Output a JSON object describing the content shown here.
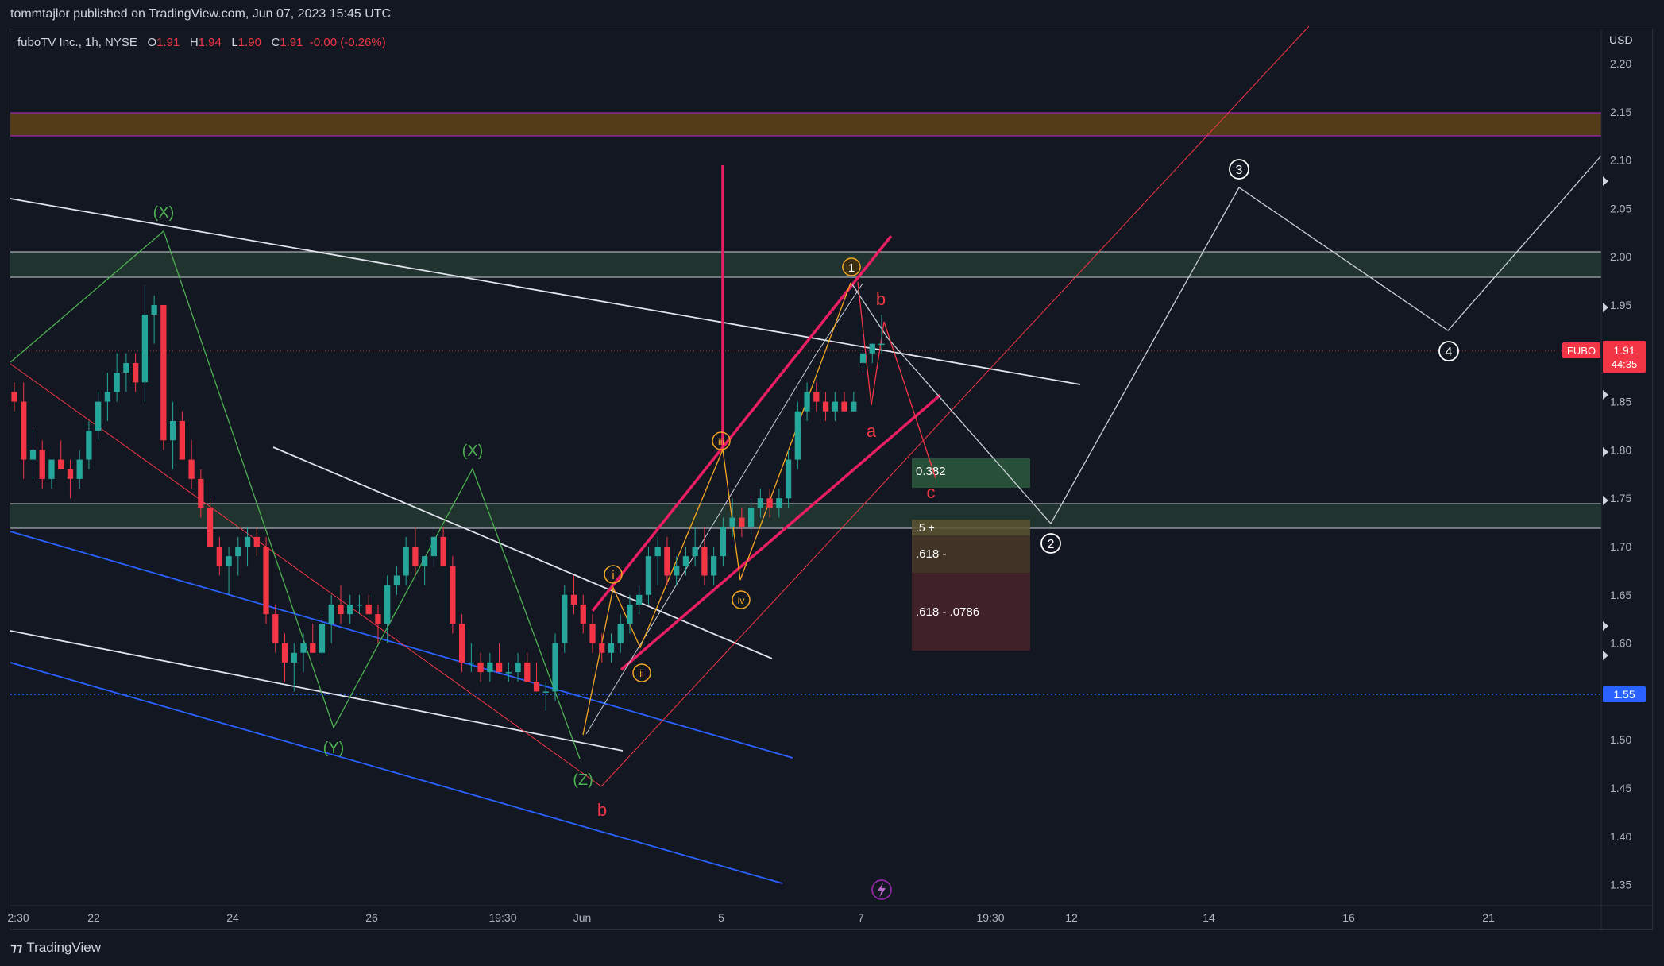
{
  "header": {
    "publisher": "tommtajlor published on TradingView.com, Jun 07, 2023 15:45 UTC"
  },
  "legend": {
    "symbol": "fuboTV Inc., 1h, NYSE",
    "o_label": "O",
    "o_value": "1.91",
    "h_label": "H",
    "h_value": "1.94",
    "l_label": "L",
    "l_value": "1.90",
    "c_label": "C",
    "c_value": "1.91",
    "change": "-0.00 (-0.26%)"
  },
  "price_scale": {
    "currency": "USD",
    "ticker_tag": "FUBO",
    "last_price": "1.91",
    "countdown": "44:35",
    "level_tag": "1.55"
  },
  "footer": {
    "brand": "TradingView"
  },
  "annotations": {
    "fib_box1": "0.382",
    "fib_box2": ".5 +",
    "fib_box3": ".618 -",
    "fib_box4": ".618 - .0786"
  },
  "colors": {
    "bull": "#26a69a",
    "bear": "#f23645",
    "pink": "#e91e63",
    "blue": "#2962ff",
    "green_wave": "#4caf50",
    "orange_wave": "#f5a623",
    "resistance_zone": "#6b4a16",
    "support_zone": "#2e4a3a"
  },
  "chart_data": {
    "type": "candlestick",
    "title": "",
    "currency": "USD",
    "interval": "1h",
    "ylim": [
      1.325,
      2.245
    ],
    "y_ticks": [
      "2.20",
      "2.15",
      "2.10",
      "2.05",
      "2.00",
      "1.95",
      "1.85",
      "1.80",
      "1.75",
      "1.70",
      "1.65",
      "1.60",
      "1.50",
      "1.45",
      "1.40",
      "1.35"
    ],
    "x_ticks": [
      "2:30",
      "22",
      "24",
      "26",
      "19:30",
      "Jun",
      "5",
      "7",
      "19:30",
      "12",
      "14",
      "16",
      "21"
    ],
    "last_close": 1.91,
    "horizontal_level": 1.55,
    "zones": [
      {
        "name": "resistance",
        "low": 2.127,
        "high": 2.153
      },
      {
        "name": "upper-support",
        "low": 1.981,
        "high": 2.008
      },
      {
        "name": "lower-support",
        "low": 1.72,
        "high": 1.747
      }
    ],
    "candles": [
      {
        "o": 1.86,
        "h": 1.87,
        "l": 1.84,
        "c": 1.85
      },
      {
        "o": 1.85,
        "h": 1.87,
        "l": 1.77,
        "c": 1.79
      },
      {
        "o": 1.79,
        "h": 1.82,
        "l": 1.77,
        "c": 1.8
      },
      {
        "o": 1.8,
        "h": 1.81,
        "l": 1.76,
        "c": 1.77
      },
      {
        "o": 1.77,
        "h": 1.79,
        "l": 1.76,
        "c": 1.79
      },
      {
        "o": 1.79,
        "h": 1.81,
        "l": 1.78,
        "c": 1.78
      },
      {
        "o": 1.78,
        "h": 1.79,
        "l": 1.75,
        "c": 1.77
      },
      {
        "o": 1.77,
        "h": 1.8,
        "l": 1.76,
        "c": 1.79
      },
      {
        "o": 1.79,
        "h": 1.83,
        "l": 1.78,
        "c": 1.82
      },
      {
        "o": 1.82,
        "h": 1.86,
        "l": 1.81,
        "c": 1.85
      },
      {
        "o": 1.85,
        "h": 1.88,
        "l": 1.83,
        "c": 1.86
      },
      {
        "o": 1.86,
        "h": 1.9,
        "l": 1.85,
        "c": 1.88
      },
      {
        "o": 1.88,
        "h": 1.9,
        "l": 1.86,
        "c": 1.89
      },
      {
        "o": 1.89,
        "h": 1.9,
        "l": 1.86,
        "c": 1.87
      },
      {
        "o": 1.87,
        "h": 1.97,
        "l": 1.85,
        "c": 1.94
      },
      {
        "o": 1.94,
        "h": 1.96,
        "l": 1.91,
        "c": 1.95
      },
      {
        "o": 1.95,
        "h": 1.95,
        "l": 1.8,
        "c": 1.81
      },
      {
        "o": 1.81,
        "h": 1.85,
        "l": 1.78,
        "c": 1.83
      },
      {
        "o": 1.83,
        "h": 1.84,
        "l": 1.79,
        "c": 1.79
      },
      {
        "o": 1.79,
        "h": 1.81,
        "l": 1.76,
        "c": 1.77
      },
      {
        "o": 1.77,
        "h": 1.78,
        "l": 1.73,
        "c": 1.74
      },
      {
        "o": 1.74,
        "h": 1.75,
        "l": 1.7,
        "c": 1.7
      },
      {
        "o": 1.7,
        "h": 1.71,
        "l": 1.67,
        "c": 1.68
      },
      {
        "o": 1.68,
        "h": 1.7,
        "l": 1.65,
        "c": 1.69
      },
      {
        "o": 1.69,
        "h": 1.71,
        "l": 1.67,
        "c": 1.7
      },
      {
        "o": 1.7,
        "h": 1.72,
        "l": 1.68,
        "c": 1.71
      },
      {
        "o": 1.71,
        "h": 1.72,
        "l": 1.69,
        "c": 1.7
      },
      {
        "o": 1.7,
        "h": 1.71,
        "l": 1.62,
        "c": 1.63
      },
      {
        "o": 1.63,
        "h": 1.64,
        "l": 1.59,
        "c": 1.6
      },
      {
        "o": 1.6,
        "h": 1.61,
        "l": 1.56,
        "c": 1.58
      },
      {
        "o": 1.58,
        "h": 1.6,
        "l": 1.55,
        "c": 1.59
      },
      {
        "o": 1.59,
        "h": 1.61,
        "l": 1.57,
        "c": 1.6
      },
      {
        "o": 1.6,
        "h": 1.62,
        "l": 1.59,
        "c": 1.59
      },
      {
        "o": 1.59,
        "h": 1.63,
        "l": 1.58,
        "c": 1.62
      },
      {
        "o": 1.62,
        "h": 1.65,
        "l": 1.6,
        "c": 1.64
      },
      {
        "o": 1.64,
        "h": 1.66,
        "l": 1.62,
        "c": 1.63
      },
      {
        "o": 1.63,
        "h": 1.65,
        "l": 1.62,
        "c": 1.64
      },
      {
        "o": 1.64,
        "h": 1.65,
        "l": 1.63,
        "c": 1.64
      },
      {
        "o": 1.64,
        "h": 1.65,
        "l": 1.63,
        "c": 1.63
      },
      {
        "o": 1.63,
        "h": 1.64,
        "l": 1.6,
        "c": 1.62
      },
      {
        "o": 1.62,
        "h": 1.67,
        "l": 1.6,
        "c": 1.66
      },
      {
        "o": 1.66,
        "h": 1.68,
        "l": 1.65,
        "c": 1.67
      },
      {
        "o": 1.67,
        "h": 1.71,
        "l": 1.66,
        "c": 1.7
      },
      {
        "o": 1.7,
        "h": 1.72,
        "l": 1.67,
        "c": 1.68
      },
      {
        "o": 1.68,
        "h": 1.69,
        "l": 1.66,
        "c": 1.69
      },
      {
        "o": 1.69,
        "h": 1.72,
        "l": 1.68,
        "c": 1.71
      },
      {
        "o": 1.71,
        "h": 1.72,
        "l": 1.68,
        "c": 1.68
      },
      {
        "o": 1.68,
        "h": 1.69,
        "l": 1.61,
        "c": 1.62
      },
      {
        "o": 1.62,
        "h": 1.63,
        "l": 1.57,
        "c": 1.58
      },
      {
        "o": 1.58,
        "h": 1.6,
        "l": 1.57,
        "c": 1.58
      },
      {
        "o": 1.58,
        "h": 1.59,
        "l": 1.56,
        "c": 1.57
      },
      {
        "o": 1.57,
        "h": 1.59,
        "l": 1.56,
        "c": 1.58
      },
      {
        "o": 1.58,
        "h": 1.6,
        "l": 1.57,
        "c": 1.57
      },
      {
        "o": 1.57,
        "h": 1.58,
        "l": 1.56,
        "c": 1.57
      },
      {
        "o": 1.57,
        "h": 1.59,
        "l": 1.56,
        "c": 1.58
      },
      {
        "o": 1.58,
        "h": 1.59,
        "l": 1.56,
        "c": 1.56
      },
      {
        "o": 1.56,
        "h": 1.58,
        "l": 1.55,
        "c": 1.55
      },
      {
        "o": 1.55,
        "h": 1.56,
        "l": 1.53,
        "c": 1.55
      },
      {
        "o": 1.55,
        "h": 1.61,
        "l": 1.54,
        "c": 1.6
      },
      {
        "o": 1.6,
        "h": 1.66,
        "l": 1.59,
        "c": 1.65
      },
      {
        "o": 1.65,
        "h": 1.67,
        "l": 1.63,
        "c": 1.64
      },
      {
        "o": 1.64,
        "h": 1.65,
        "l": 1.61,
        "c": 1.62
      },
      {
        "o": 1.62,
        "h": 1.63,
        "l": 1.59,
        "c": 1.6
      },
      {
        "o": 1.6,
        "h": 1.61,
        "l": 1.58,
        "c": 1.59
      },
      {
        "o": 1.59,
        "h": 1.61,
        "l": 1.58,
        "c": 1.6
      },
      {
        "o": 1.6,
        "h": 1.63,
        "l": 1.59,
        "c": 1.62
      },
      {
        "o": 1.62,
        "h": 1.65,
        "l": 1.61,
        "c": 1.64
      },
      {
        "o": 1.64,
        "h": 1.66,
        "l": 1.63,
        "c": 1.65
      },
      {
        "o": 1.65,
        "h": 1.7,
        "l": 1.64,
        "c": 1.69
      },
      {
        "o": 1.69,
        "h": 1.71,
        "l": 1.66,
        "c": 1.7
      },
      {
        "o": 1.7,
        "h": 1.71,
        "l": 1.66,
        "c": 1.67
      },
      {
        "o": 1.67,
        "h": 1.69,
        "l": 1.66,
        "c": 1.68
      },
      {
        "o": 1.68,
        "h": 1.7,
        "l": 1.67,
        "c": 1.69
      },
      {
        "o": 1.69,
        "h": 1.72,
        "l": 1.68,
        "c": 1.7
      },
      {
        "o": 1.7,
        "h": 1.72,
        "l": 1.66,
        "c": 1.67
      },
      {
        "o": 1.67,
        "h": 1.7,
        "l": 1.66,
        "c": 1.69
      },
      {
        "o": 1.69,
        "h": 1.73,
        "l": 1.68,
        "c": 1.72
      },
      {
        "o": 1.72,
        "h": 1.75,
        "l": 1.71,
        "c": 1.73
      },
      {
        "o": 1.73,
        "h": 1.74,
        "l": 1.71,
        "c": 1.72
      },
      {
        "o": 1.72,
        "h": 1.75,
        "l": 1.71,
        "c": 1.74
      },
      {
        "o": 1.74,
        "h": 1.76,
        "l": 1.73,
        "c": 1.75
      },
      {
        "o": 1.75,
        "h": 1.76,
        "l": 1.73,
        "c": 1.74
      },
      {
        "o": 1.74,
        "h": 1.76,
        "l": 1.73,
        "c": 1.75
      },
      {
        "o": 1.75,
        "h": 1.8,
        "l": 1.74,
        "c": 1.79
      },
      {
        "o": 1.79,
        "h": 1.85,
        "l": 1.78,
        "c": 1.84
      },
      {
        "o": 1.84,
        "h": 1.87,
        "l": 1.83,
        "c": 1.86
      },
      {
        "o": 1.86,
        "h": 1.87,
        "l": 1.84,
        "c": 1.85
      },
      {
        "o": 1.85,
        "h": 1.86,
        "l": 1.83,
        "c": 1.84
      },
      {
        "o": 1.84,
        "h": 1.86,
        "l": 1.83,
        "c": 1.85
      },
      {
        "o": 1.85,
        "h": 1.86,
        "l": 1.84,
        "c": 1.84
      },
      {
        "o": 1.84,
        "h": 1.86,
        "l": 1.84,
        "c": 1.85
      },
      {
        "o": 1.89,
        "h": 1.92,
        "l": 1.88,
        "c": 1.9
      },
      {
        "o": 1.9,
        "h": 1.91,
        "l": 1.89,
        "c": 1.91
      },
      {
        "o": 1.91,
        "h": 1.94,
        "l": 1.9,
        "c": 1.91
      }
    ]
  }
}
